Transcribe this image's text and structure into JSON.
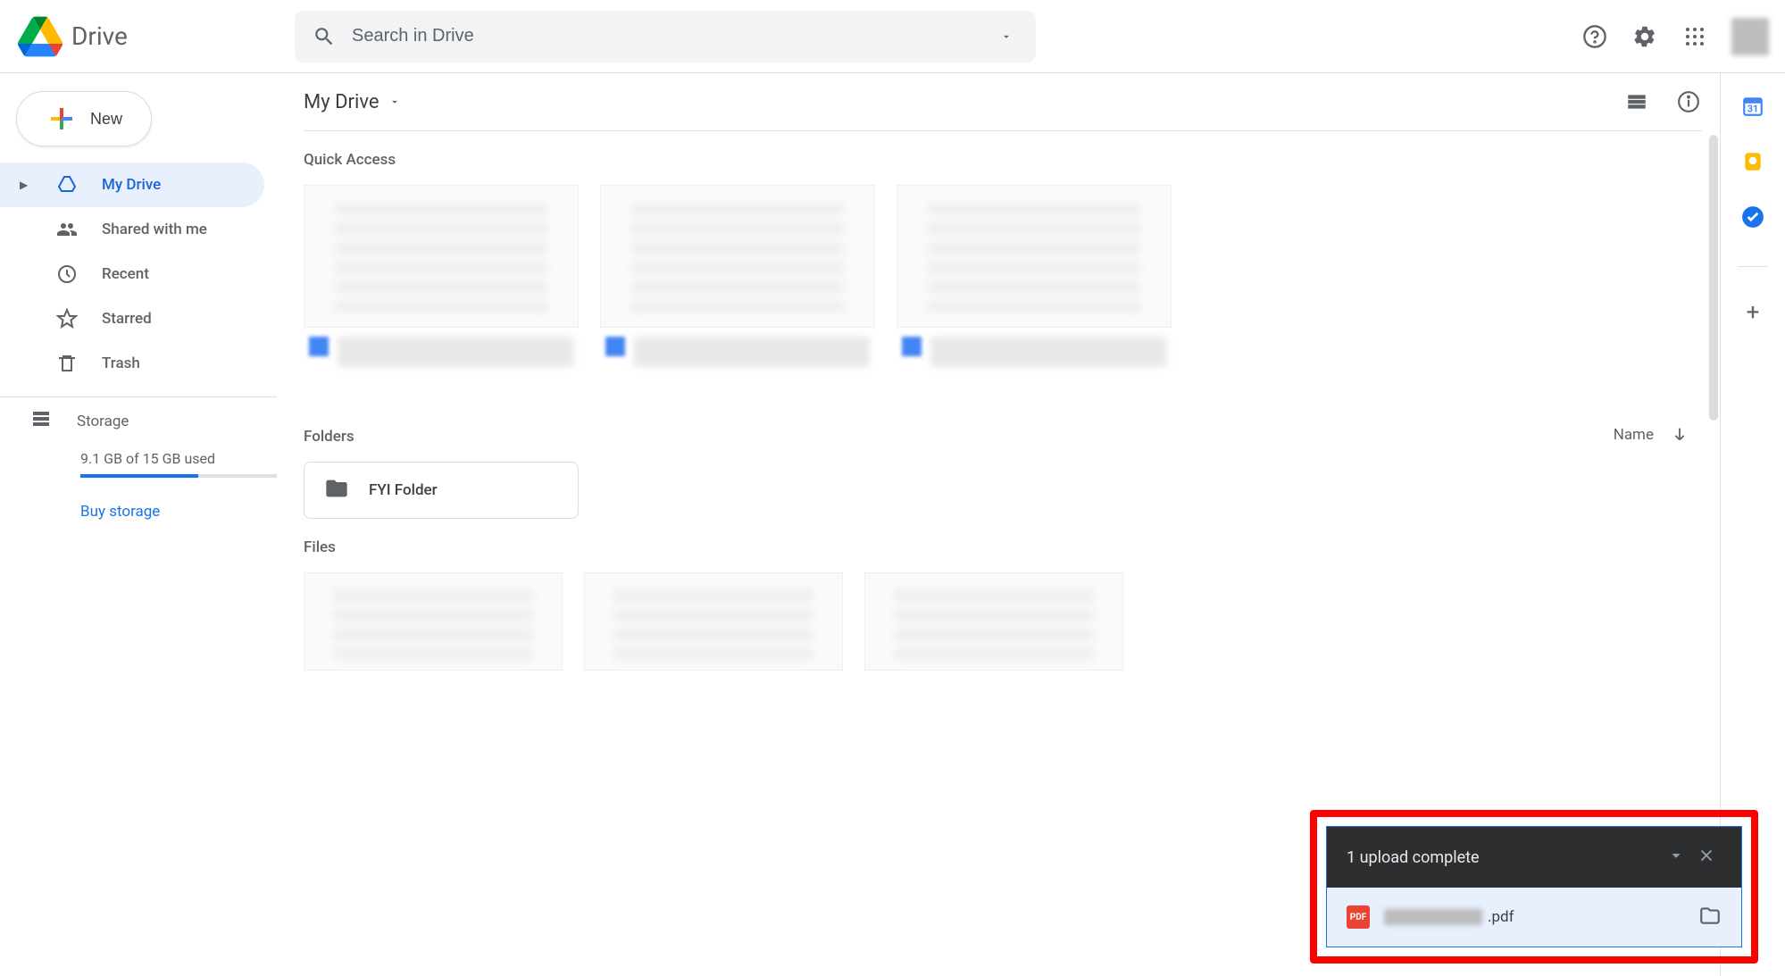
{
  "header": {
    "product": "Drive",
    "search_placeholder": "Search in Drive"
  },
  "sidebar": {
    "new_label": "New",
    "items": [
      {
        "label": "My Drive"
      },
      {
        "label": "Shared with me"
      },
      {
        "label": "Recent"
      },
      {
        "label": "Starred"
      },
      {
        "label": "Trash"
      }
    ],
    "storage_label": "Storage",
    "storage_text": "9.1 GB of 15 GB used",
    "storage_pct": 60,
    "buy_label": "Buy storage"
  },
  "main": {
    "breadcrumb": "My Drive",
    "quick_access_label": "Quick Access",
    "folders_label": "Folders",
    "sort_label": "Name",
    "folders": [
      {
        "name": "FYI Folder"
      }
    ],
    "files_label": "Files"
  },
  "upload": {
    "title": "1 upload complete",
    "file_ext": ".pdf",
    "pdf_badge": "PDF"
  }
}
